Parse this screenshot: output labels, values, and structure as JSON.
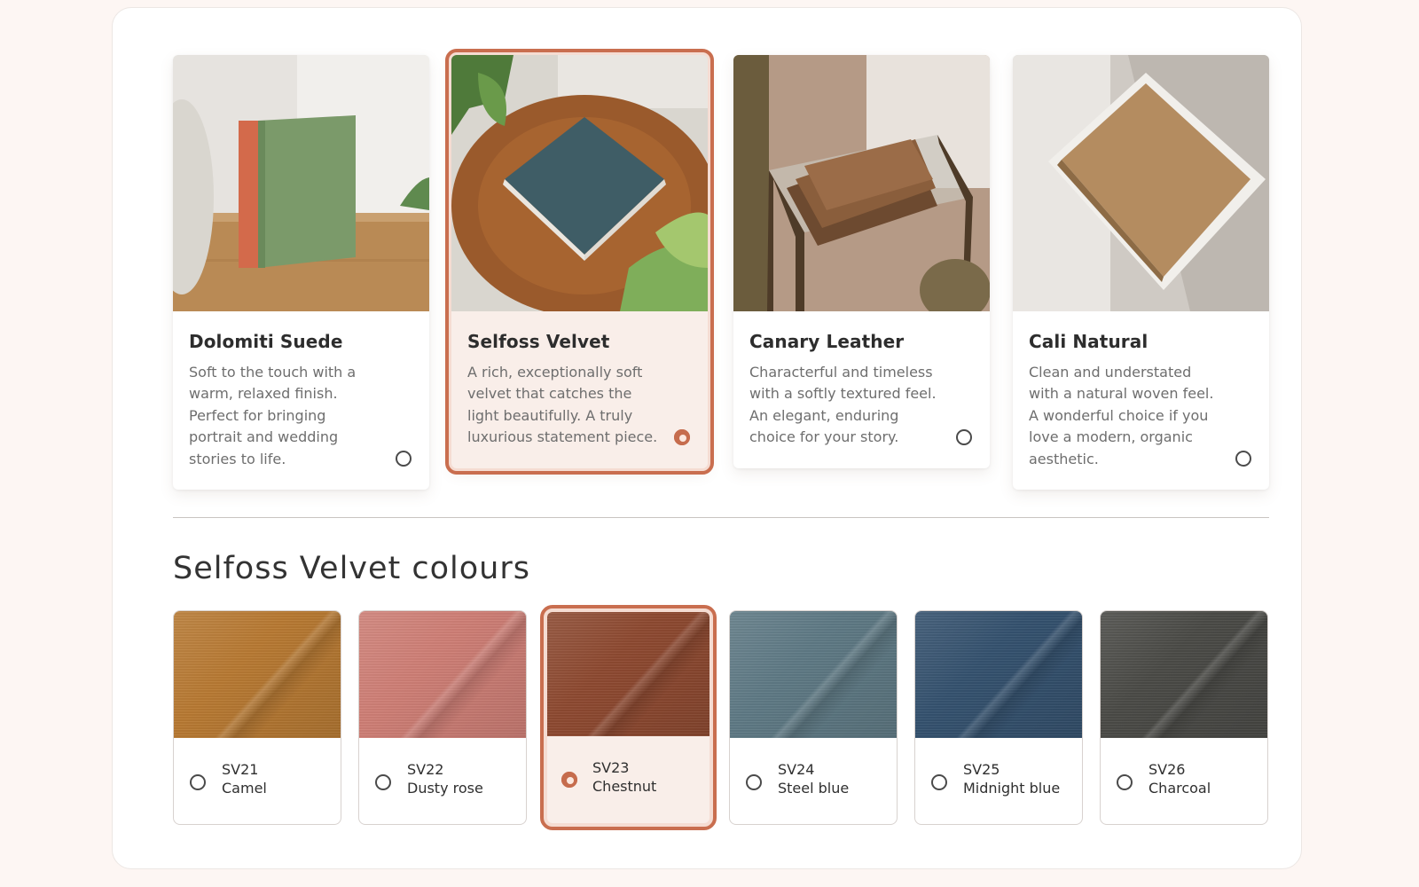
{
  "materials": [
    {
      "name": "Dolomiti Suede",
      "description": "Soft to the touch with a warm, relaxed finish. Perfect for bringing portrait and wedding stories to life.",
      "selected": false
    },
    {
      "name": "Selfoss Velvet",
      "description": "A rich, exceptionally soft velvet that catches the light beautifully. A truly luxurious statement piece.",
      "selected": true
    },
    {
      "name": "Canary Leather",
      "description": "Characterful and timeless with a softly textured feel. An elegant, enduring choice for your story.",
      "selected": false
    },
    {
      "name": "Cali Natural",
      "description": "Clean and understated with a natural woven feel. A wonderful choice if you love a modern, organic aesthetic.",
      "selected": false
    }
  ],
  "colours_section": {
    "title": "Selfoss Velvet colours"
  },
  "swatches": [
    {
      "code": "SV21",
      "name": "Camel",
      "color": "#b87a33",
      "selected": false
    },
    {
      "code": "SV22",
      "name": "Dusty rose",
      "color": "#cf7f76",
      "selected": false
    },
    {
      "code": "SV23",
      "name": "Chestnut",
      "color": "#8e4a31",
      "selected": true
    },
    {
      "code": "SV24",
      "name": "Steel blue",
      "color": "#5f7a85",
      "selected": false
    },
    {
      "code": "SV25",
      "name": "Midnight blue",
      "color": "#35526f",
      "selected": false
    },
    {
      "code": "SV26",
      "name": "Charcoal",
      "color": "#4b4b47",
      "selected": false
    }
  ],
  "accent_color": "#c96e4f"
}
